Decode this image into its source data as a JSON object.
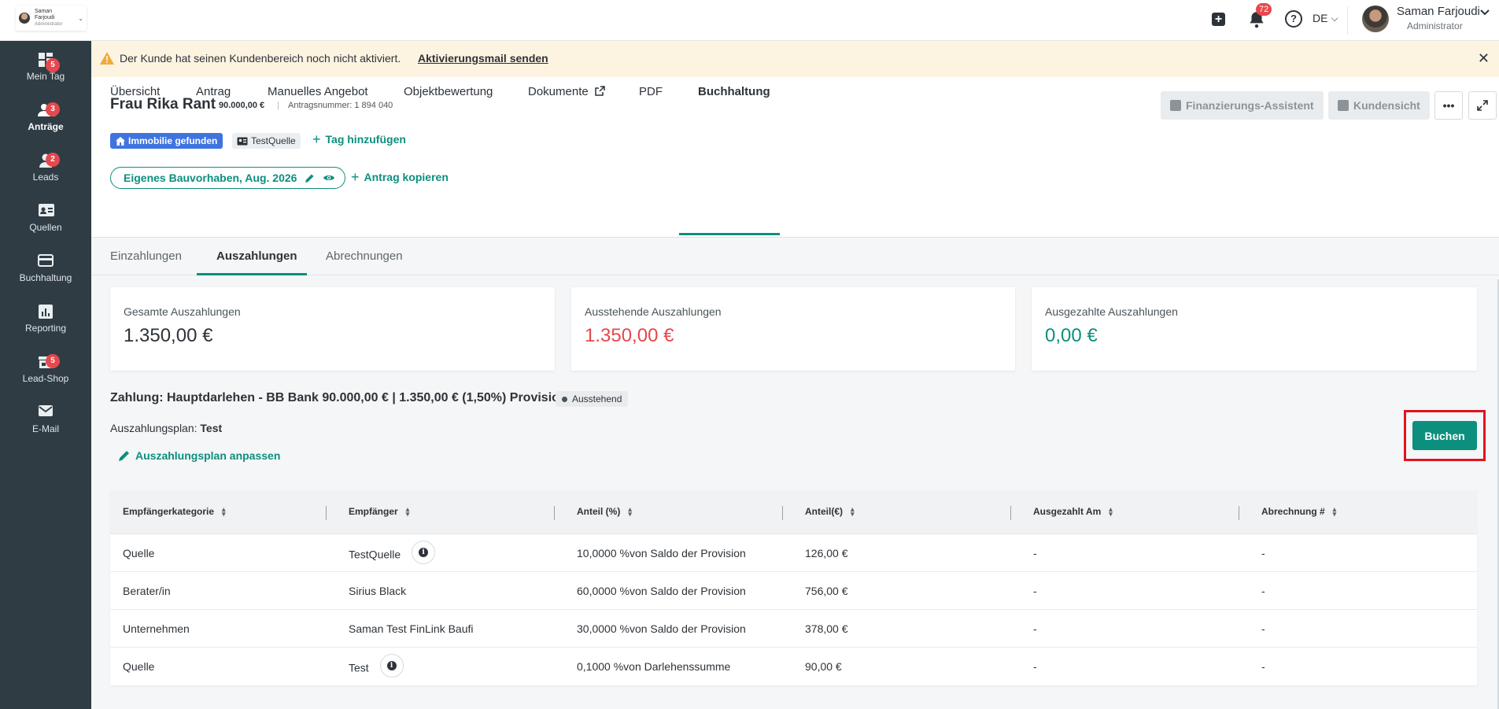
{
  "topbar": {
    "brand_name": "Saman Farjoudi",
    "brand_role": "Administrator",
    "notifications_count": "72",
    "language": "DE",
    "user_name": "Saman Farjoudi",
    "user_role": "Administrator"
  },
  "sidebar": {
    "items": [
      {
        "label": "Mein Tag",
        "badge": "5",
        "icon": "dashboard-icon"
      },
      {
        "label": "Anträge",
        "badge": "3",
        "icon": "users-icon"
      },
      {
        "label": "Leads",
        "badge": "2",
        "icon": "person-icon"
      },
      {
        "label": "Quellen",
        "badge": "",
        "icon": "id-card-icon"
      },
      {
        "label": "Buchhaltung",
        "badge": "",
        "icon": "credit-card-icon"
      },
      {
        "label": "Reporting",
        "badge": "",
        "icon": "chart-icon"
      },
      {
        "label": "Lead-Shop",
        "badge": "5",
        "icon": "shop-icon"
      },
      {
        "label": "E-Mail",
        "badge": "",
        "icon": "mail-icon"
      }
    ]
  },
  "banner": {
    "message": "Der Kunde hat seinen Kundenbereich noch nicht aktiviert.",
    "link": "Aktivierungsmail senden"
  },
  "header": {
    "customer_name": "Frau Rika Rant",
    "amount": "90.000,00 €",
    "separator": "|",
    "antrag_nr": "Antragsnummer: 1 894 040",
    "btn_finanzierung": "Finanzierungs-Assistent",
    "btn_kundensicht": "Kundensicht",
    "tag_immobilie": "Immobilie gefunden",
    "tag_quelle": "TestQuelle",
    "add_tag": "Tag hinzufügen",
    "project": "Eigenes Bauvorhaben, Aug. 2026",
    "copy": "Antrag kopieren"
  },
  "tabs": [
    "Übersicht",
    "Antrag",
    "Manuelles Angebot",
    "Objektbewertung",
    "Dokumente",
    "PDF",
    "Buchhaltung"
  ],
  "subtabs": [
    "Einzahlungen",
    "Auszahlungen",
    "Abrechnungen"
  ],
  "cards": [
    {
      "title": "Gesamte Auszahlungen",
      "value": "1.350,00 €"
    },
    {
      "title": "Ausstehende Auszahlungen",
      "value": "1.350,00 €"
    },
    {
      "title": "Ausgezahlte Auszahlungen",
      "value": "0,00 €"
    }
  ],
  "payment": {
    "title": "Zahlung: Hauptdarlehen - BB Bank 90.000,00 € | 1.350,00 € (1,50%) Provision",
    "status": "Ausstehend",
    "plan_label": "Auszahlungsplan:",
    "plan_name": "Test",
    "plan_edit": "Auszahlungsplan anpassen",
    "book_button": "Buchen"
  },
  "table": {
    "headers": [
      "Empfängerkategorie",
      "Empfänger",
      "Anteil (%)",
      "Anteil(€)",
      "Ausgezahlt Am",
      "Abrechnung #"
    ],
    "rows": [
      [
        "Quelle",
        "TestQuelle",
        "10,0000 %von Saldo der Provision",
        "126,00 €",
        "-",
        "-"
      ],
      [
        "Berater/in",
        "Sirius Black",
        "60,0000 %von Saldo der Provision",
        "756,00 €",
        "-",
        "-"
      ],
      [
        "Unternehmen",
        "Saman Test FinLink Baufi",
        "30,0000 %von Saldo der Provision",
        "378,00 €",
        "-",
        "-"
      ],
      [
        "Quelle",
        "Test",
        "0,1000 %von Darlehenssumme",
        "90,00 €",
        "-",
        "-"
      ]
    ]
  },
  "colors": {
    "accent": "#0d8f7e",
    "sidebar": "#2f3c43",
    "danger": "#e5484d",
    "tag_blue": "#3f74e0",
    "banner": "#fdf3e1"
  }
}
